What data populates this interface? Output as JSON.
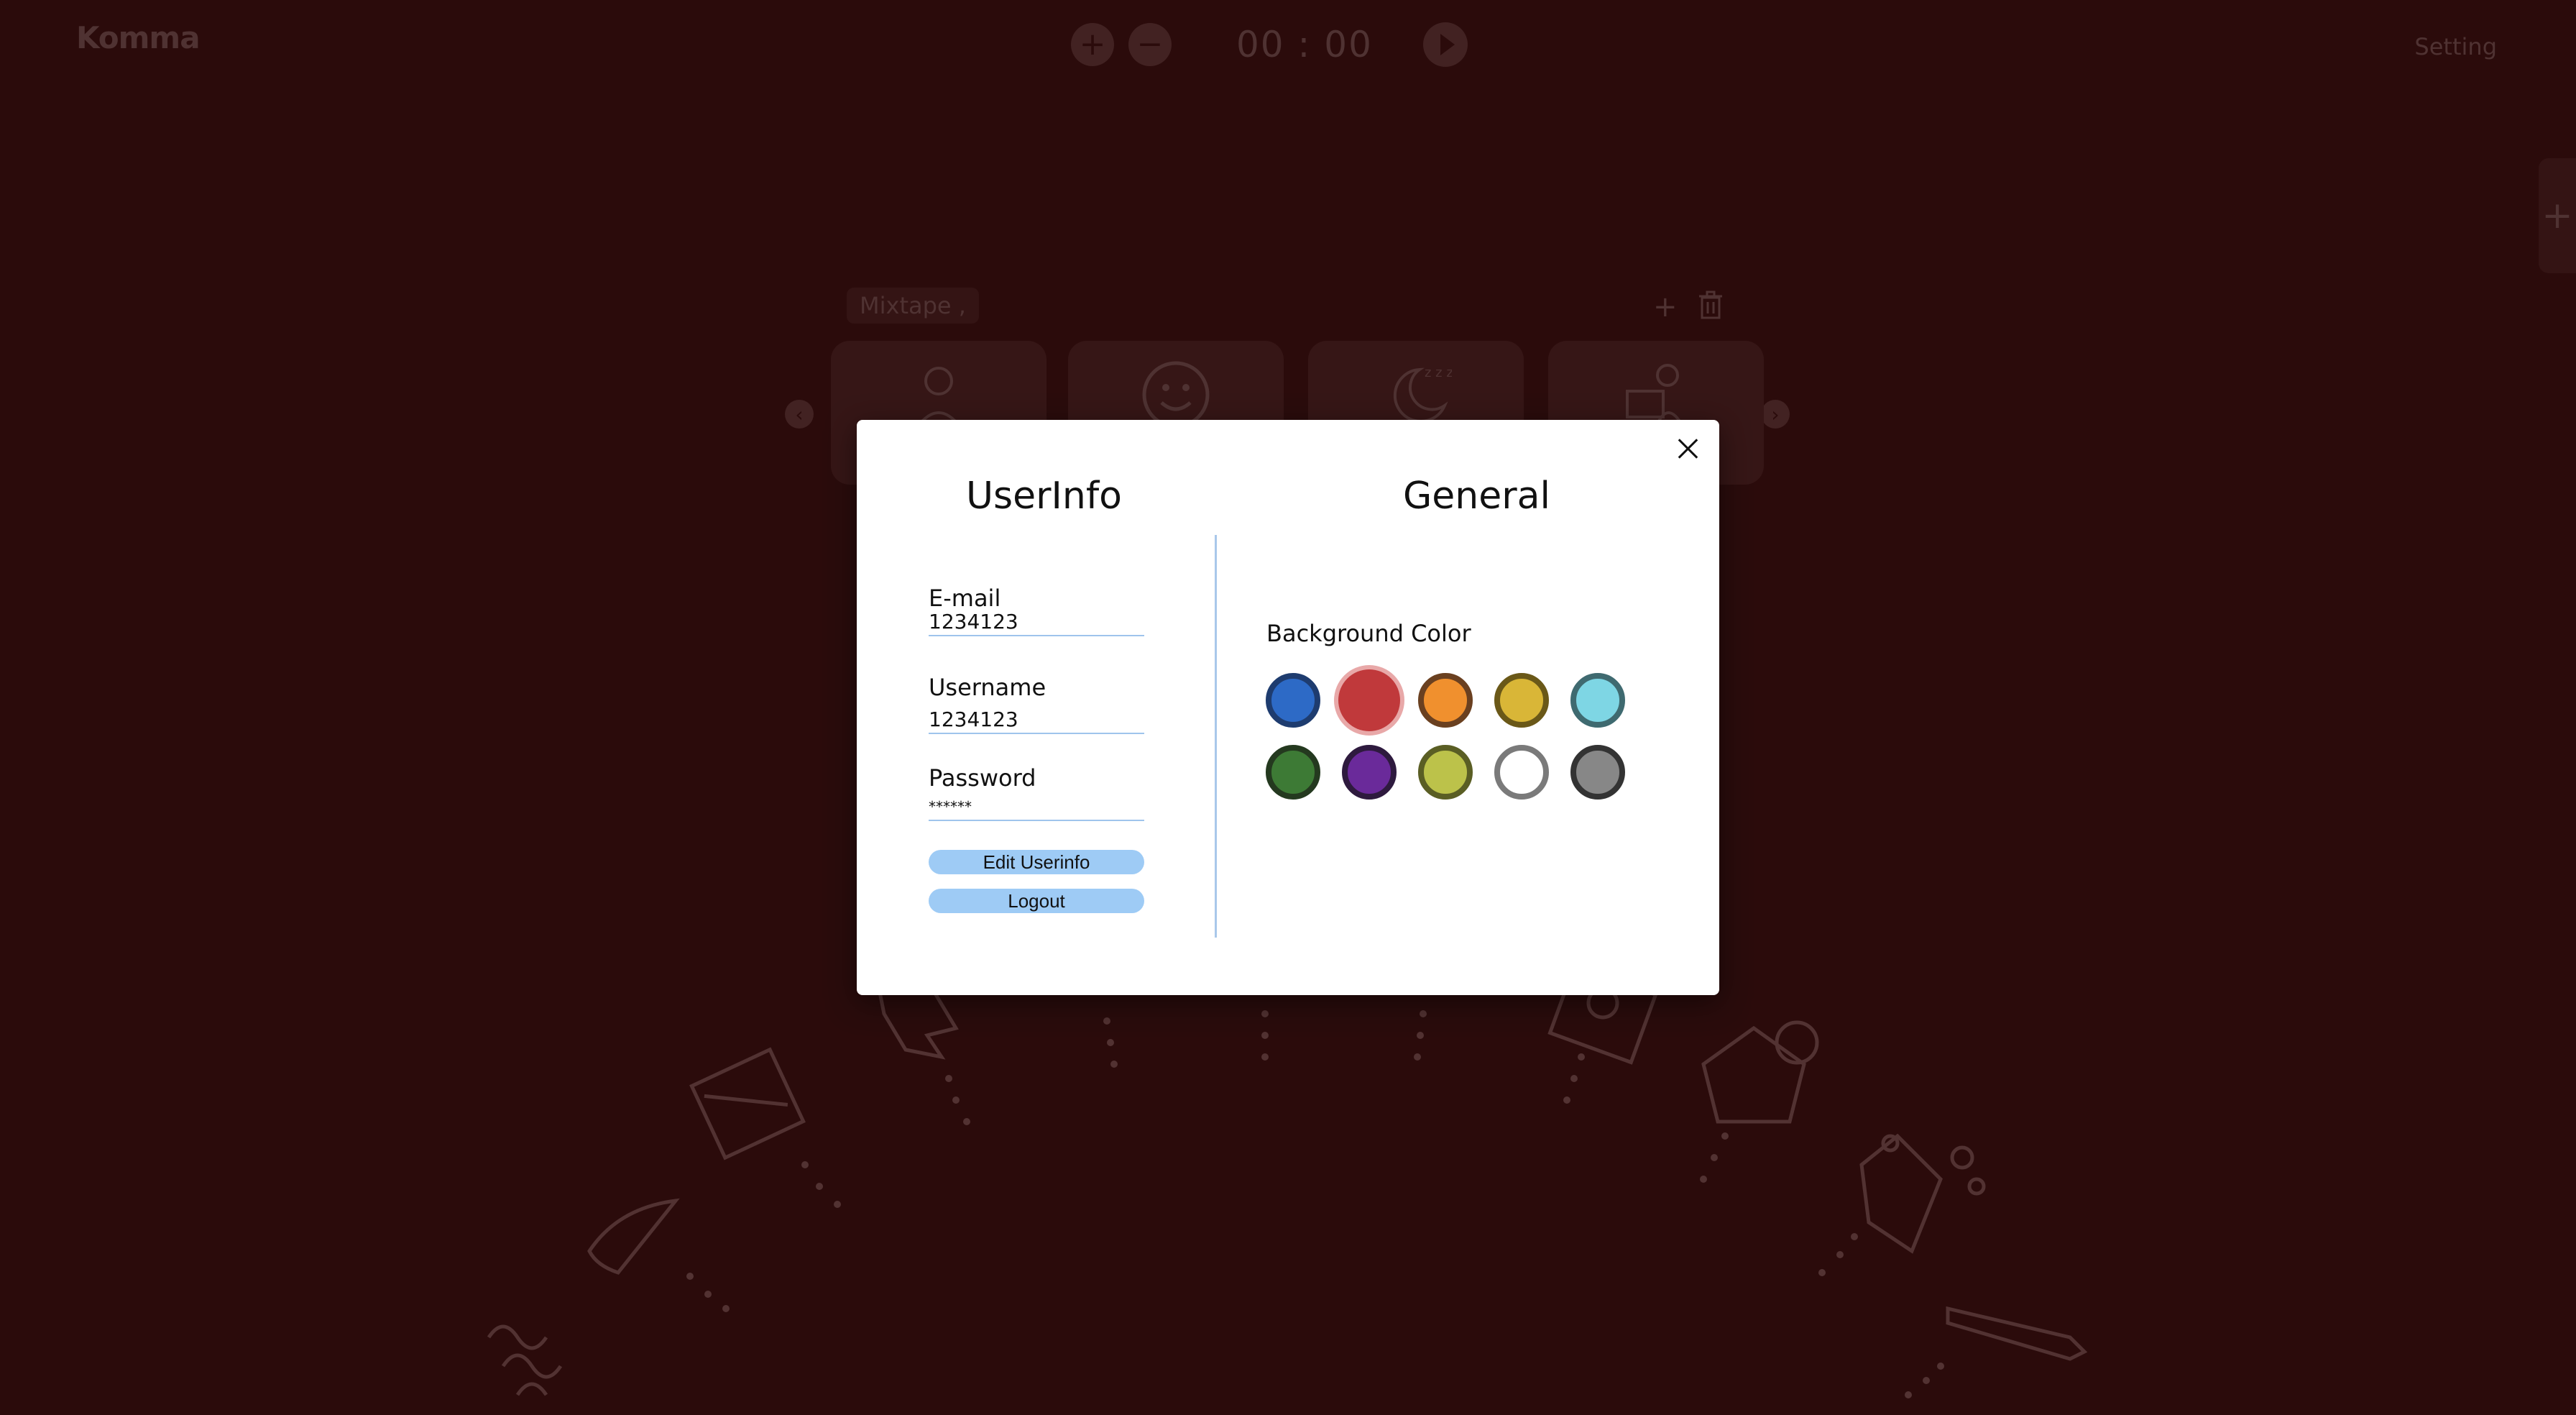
{
  "app": {
    "logo": "Komma",
    "setting_label": "Setting",
    "timer": "00 : 00"
  },
  "controls": {
    "plus_label": "+",
    "minus_label": "−",
    "side_add_label": "+"
  },
  "mixtape": {
    "label": "Mixtape ,",
    "add_label": "+",
    "cards": [
      "sleeping-icon",
      "smile-icon",
      "moon-icon",
      "office-worker-icon"
    ]
  },
  "modal": {
    "userinfo_title": "UserInfo",
    "general_title": "General",
    "email_label": "E-mail",
    "email_value": "1234123",
    "username_label": "Username",
    "username_value": "1234123",
    "password_label": "Password",
    "password_value": "******",
    "edit_button": "Edit Userinfo",
    "logout_button": "Logout",
    "background_color_label": "Background Color",
    "swatches": [
      {
        "name": "blue",
        "fill": "#2d6ac6",
        "border": "#1e3c6f",
        "selected": false
      },
      {
        "name": "red",
        "fill": "#c0393b",
        "border": "#c0393b",
        "selected": true
      },
      {
        "name": "orange",
        "fill": "#f0902e",
        "border": "#6a4020",
        "selected": false
      },
      {
        "name": "yellow",
        "fill": "#d9b637",
        "border": "#6a5818",
        "selected": false
      },
      {
        "name": "cyan",
        "fill": "#7ed6e4",
        "border": "#3f6a70",
        "selected": false
      },
      {
        "name": "green",
        "fill": "#3d7a35",
        "border": "#24391f",
        "selected": false
      },
      {
        "name": "purple",
        "fill": "#6a2a9a",
        "border": "#2e1a3e",
        "selected": false
      },
      {
        "name": "lime",
        "fill": "#bcc24a",
        "border": "#5a5e24",
        "selected": false
      },
      {
        "name": "white",
        "fill": "#ffffff",
        "border": "#7a7a7a",
        "selected": false
      },
      {
        "name": "gray",
        "fill": "#878787",
        "border": "#333333",
        "selected": false
      }
    ]
  }
}
